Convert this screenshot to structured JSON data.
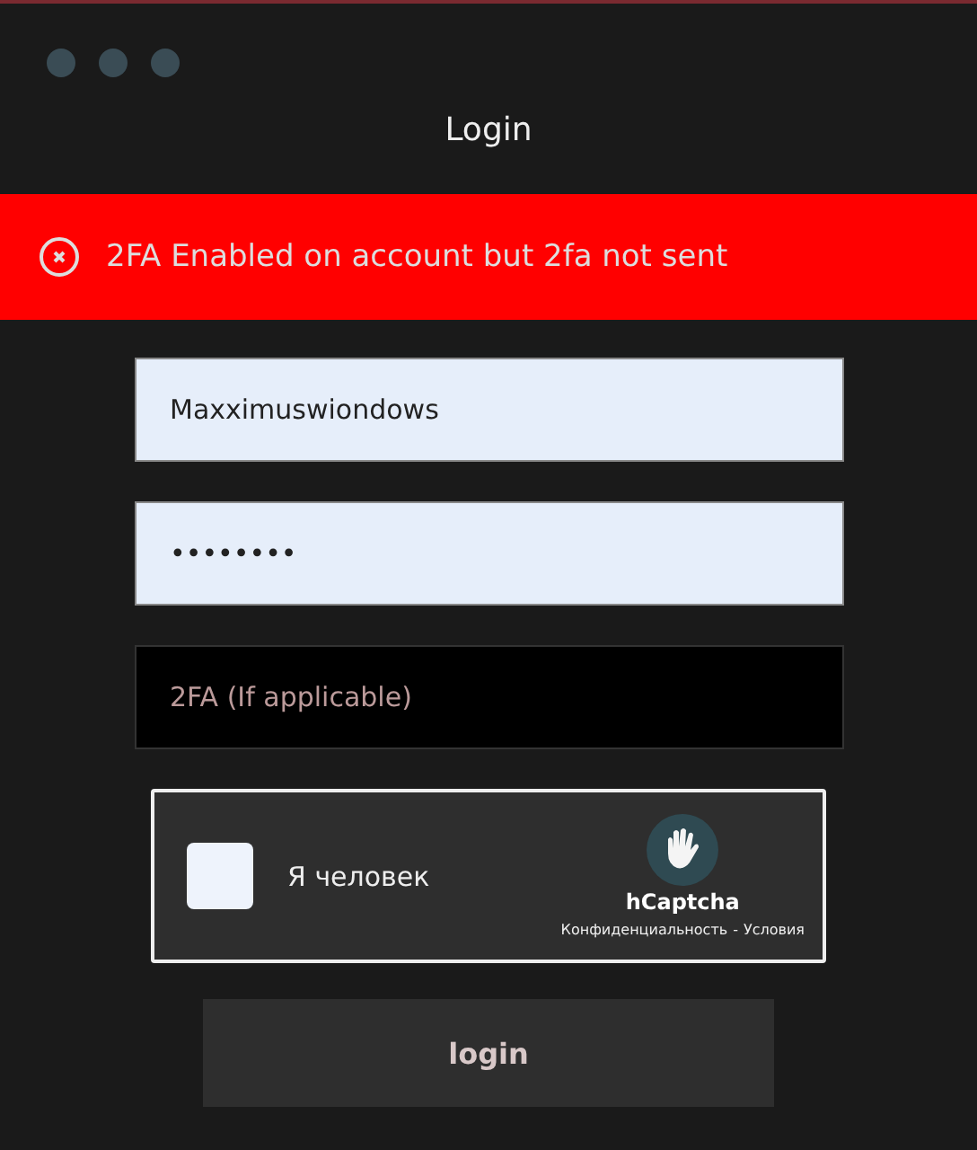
{
  "window": {
    "title": "Login"
  },
  "error": {
    "message": "2FA Enabled on account but 2fa not sent"
  },
  "fields": [
    {
      "kind": "filled",
      "value": "Maxximuswiondows"
    },
    {
      "kind": "filled",
      "value": "••••••••"
    },
    {
      "kind": "empty",
      "placeholder": "2FA (If applicable)"
    }
  ],
  "captcha": {
    "checked": false,
    "label": "Я человек",
    "brand": "hCaptcha",
    "links": [
      "Конфиденциальность",
      "Условия"
    ],
    "separator": "-"
  },
  "submit": {
    "label": "login"
  }
}
